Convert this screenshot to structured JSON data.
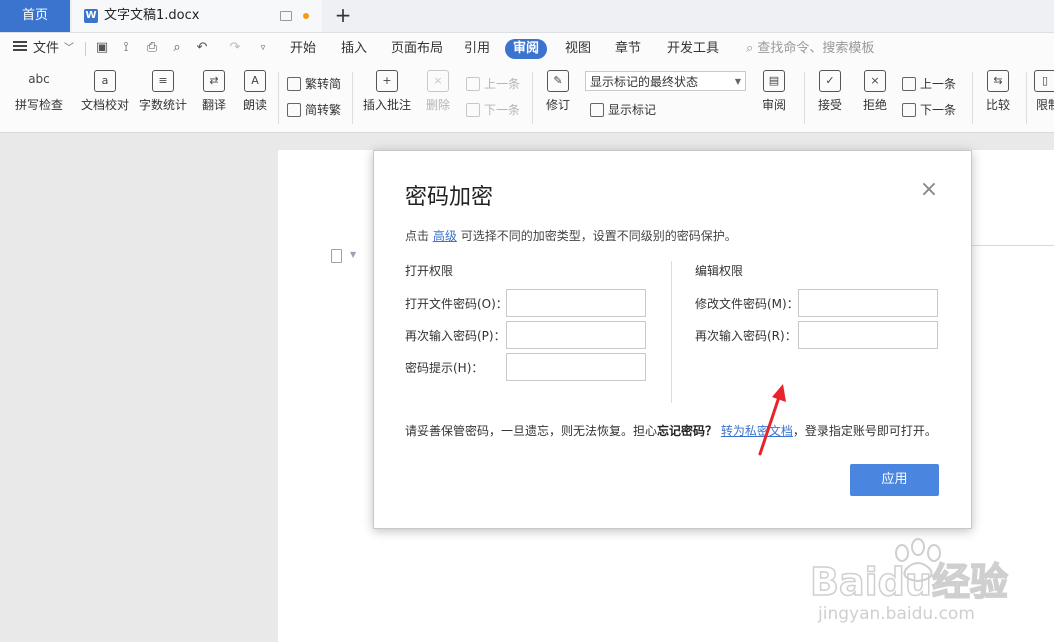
{
  "tabs": {
    "home": "首页",
    "doc_title": "文字文稿1.docx",
    "doc_icon": "W"
  },
  "menu": {
    "file": "文件",
    "items": [
      "开始",
      "插入",
      "页面布局",
      "引用",
      "审阅",
      "视图",
      "章节",
      "开发工具"
    ],
    "active": "审阅",
    "search": "查找命令、搜索模板"
  },
  "ribbon": {
    "spell_check": "拼写检查",
    "doc_proof": "文档校对",
    "word_count": "字数统计",
    "translate": "翻译",
    "read_aloud": "朗读",
    "trad_to_simp": "繁转简",
    "simp_to_trad": "简转繁",
    "insert_comment": "插入批注",
    "delete": "删除",
    "prev": "上一条",
    "next": "下一条",
    "track_changes": "修订",
    "markup_state": "显示标记的最终状态",
    "show_markup": "显示标记",
    "review": "审阅",
    "accept": "接受",
    "reject": "拒绝",
    "prev2": "上一条",
    "next2": "下一条",
    "compare": "比较",
    "restrict": "限制"
  },
  "dialog": {
    "title": "密码加密",
    "hint_prefix": "点击",
    "hint_link": "高级",
    "hint_suffix": "可选择不同的加密类型，设置不同级别的密码保护。",
    "open_section": "打开权限",
    "edit_section": "编辑权限",
    "open_pw_label": "打开文件密码(O)：",
    "open_pw_confirm_label": "再次输入密码(P)：",
    "pw_hint_label": "密码提示(H)：",
    "edit_pw_label": "修改文件密码(M)：",
    "edit_pw_confirm_label": "再次输入密码(R)：",
    "warn_text": "请妥善保管密码，一旦遗忘，则无法恢复。担心",
    "warn_bold": "忘记密码？",
    "warn_link": "转为私密文档",
    "warn_suffix": "，登录指定账号即可打开。",
    "apply": "应用"
  },
  "watermark": {
    "brand": "Baidu经验",
    "url": "jingyan.baidu.com"
  },
  "colors": {
    "accent": "#3b74cf",
    "apply_button": "#4a86e0",
    "arrow": "#e8232a"
  }
}
